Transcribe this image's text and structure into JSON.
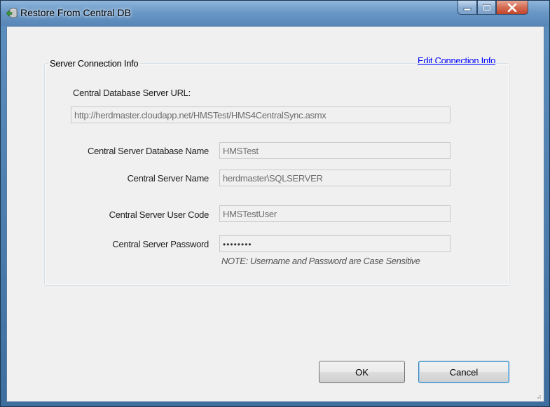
{
  "window": {
    "title": "Restore From Central DB",
    "controls": {
      "minimize": "minimize-icon",
      "maximize": "maximize-icon",
      "close": "close-icon"
    }
  },
  "link": {
    "edit_connection": "Edit Connection Info"
  },
  "group": {
    "legend": "Server Connection Info",
    "url_label": "Central Database Server URL:",
    "url_value": "http://herdmaster.cloudapp.net/HMSTest/HMS4CentralSync.asmx",
    "db_name_label": "Central Server Database Name",
    "db_name_value": "HMSTest",
    "server_name_label": "Central Server Name",
    "server_name_value": "herdmaster\\SQLSERVER",
    "user_code_label": "Central Server User Code",
    "user_code_value": "HMSTestUser",
    "password_label": "Central Server Password",
    "password_value": "••••••••",
    "note": "NOTE: Username and Password are Case Sensitive"
  },
  "buttons": {
    "ok": "OK",
    "cancel": "Cancel"
  },
  "colors": {
    "link": "#0000ff",
    "client_bg": "#f0f0f0",
    "titlebar": "#6b98c6",
    "close": "#c4442b"
  }
}
